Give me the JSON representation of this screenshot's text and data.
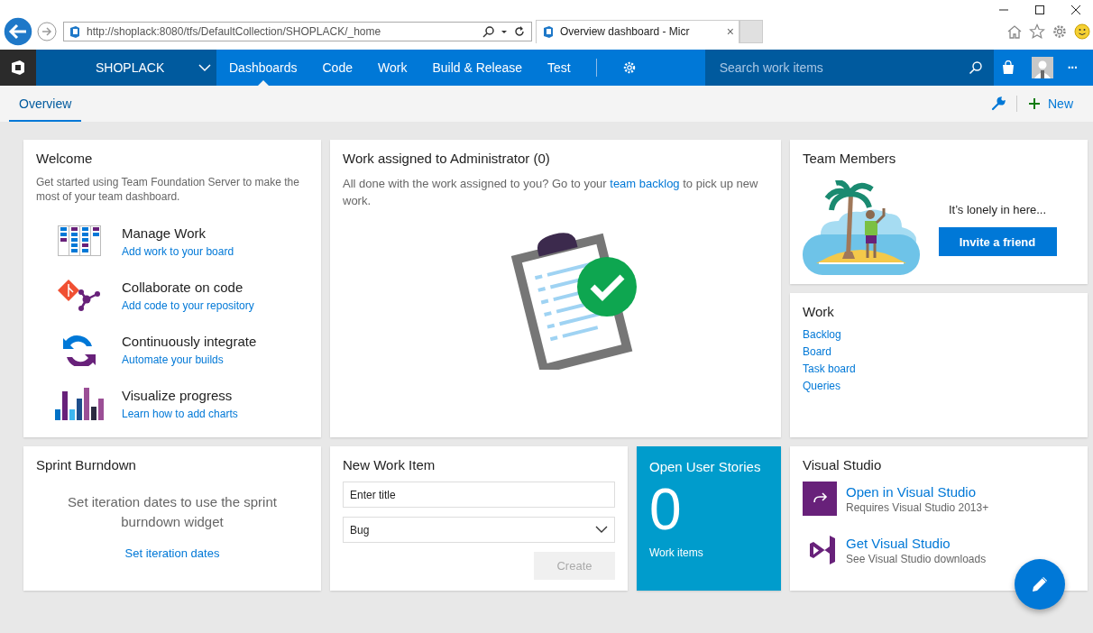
{
  "browser": {
    "url": "http://shoplack:8080/tfs/DefaultCollection/SHOPLACK/_home",
    "tab_title": "Overview dashboard - Micr",
    "tab_close": "×"
  },
  "nav": {
    "project": "SHOPLACK",
    "tabs": [
      {
        "label": "Dashboards",
        "selected": true
      },
      {
        "label": "Code",
        "selected": false
      },
      {
        "label": "Work",
        "selected": false
      },
      {
        "label": "Build & Release",
        "selected": false
      },
      {
        "label": "Test",
        "selected": false
      }
    ],
    "search_placeholder": "Search work items",
    "more": "···"
  },
  "subnav": {
    "tabs": [
      {
        "label": "Overview",
        "selected": true
      }
    ],
    "new_label": "New"
  },
  "welcome": {
    "title": "Welcome",
    "intro": "Get started using Team Foundation Server to make the most of your team dashboard.",
    "items": [
      {
        "kind": "board",
        "title": "Manage Work",
        "link": "Add work to your board"
      },
      {
        "kind": "code",
        "title": "Collaborate on code",
        "link": "Add code to your repository"
      },
      {
        "kind": "build",
        "title": "Continuously integrate",
        "link": "Automate your builds"
      },
      {
        "kind": "charts",
        "title": "Visualize progress",
        "link": "Learn how to add charts"
      }
    ]
  },
  "work_assigned": {
    "title": "Work assigned to Administrator (0)",
    "message_before": "All done with the work assigned to you? Go to your ",
    "link": "team backlog",
    "message_after": " to pick up new work."
  },
  "team_members": {
    "title": "Team Members",
    "message": "It’s lonely in here...",
    "button": "Invite a friend"
  },
  "work": {
    "title": "Work",
    "links": [
      "Backlog",
      "Board",
      "Task board",
      "Queries"
    ]
  },
  "sprint_burndown": {
    "title": "Sprint Burndown",
    "message": "Set iteration dates to use the sprint burndown widget",
    "link": "Set iteration dates"
  },
  "new_work_item": {
    "title": "New Work Item",
    "title_placeholder": "Enter title",
    "type": "Bug",
    "button": "Create",
    "button_disabled": true
  },
  "open_user_stories": {
    "title": "Open User Stories",
    "count": "0",
    "caption": "Work items"
  },
  "visual_studio": {
    "title": "Visual Studio",
    "items": [
      {
        "kind": "open",
        "title": "Open in Visual Studio",
        "subtitle": "Requires Visual Studio 2013+"
      },
      {
        "kind": "get",
        "title": "Get Visual Studio",
        "subtitle": "See Visual Studio downloads"
      }
    ]
  }
}
